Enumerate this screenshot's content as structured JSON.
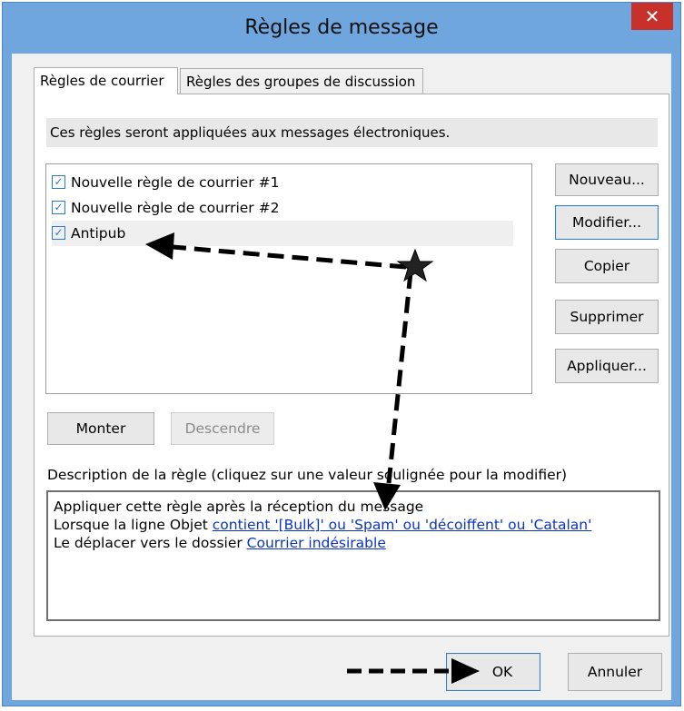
{
  "window": {
    "title": "Règles de message",
    "close_glyph": "✕"
  },
  "tabs": [
    {
      "label": "Règles de courrier",
      "active": true
    },
    {
      "label": "Règles des groupes de discussion",
      "active": false
    }
  ],
  "info_text": "Ces règles seront appliquées aux messages électroniques.",
  "rules": [
    {
      "label": "Nouvelle règle de courrier #1",
      "checked": true,
      "selected": false
    },
    {
      "label": "Nouvelle règle de courrier #2",
      "checked": true,
      "selected": false
    },
    {
      "label": "Antipub",
      "checked": true,
      "selected": true
    }
  ],
  "side_buttons": {
    "new": "Nouveau...",
    "modify": "Modifier...",
    "copy": "Copier",
    "delete": "Supprimer",
    "apply": "Appliquer..."
  },
  "order_buttons": {
    "up": "Monter",
    "down": "Descendre"
  },
  "description": {
    "label": "Description de la règle (cliquez sur une valeur soulignée pour la modifier)",
    "line1": "Appliquer cette règle après la réception du message",
    "line2_prefix": "Lorsque la ligne Objet ",
    "line2_link": "contient '[Bulk]' ou 'Spam' ou 'décoiffent' ou 'Catalan'",
    "line3_prefix": "Le déplacer vers le dossier ",
    "line3_link": "Courrier indésirable"
  },
  "footer": {
    "ok": "OK",
    "cancel": "Annuler"
  },
  "colors": {
    "title_bar": "#6ea6dd",
    "close_button": "#c7312a",
    "link": "#0a33c7",
    "checkbox": "#2a7bd4"
  },
  "annotations": {
    "star_icon": "star-icon",
    "arrow_color": "#000000"
  }
}
